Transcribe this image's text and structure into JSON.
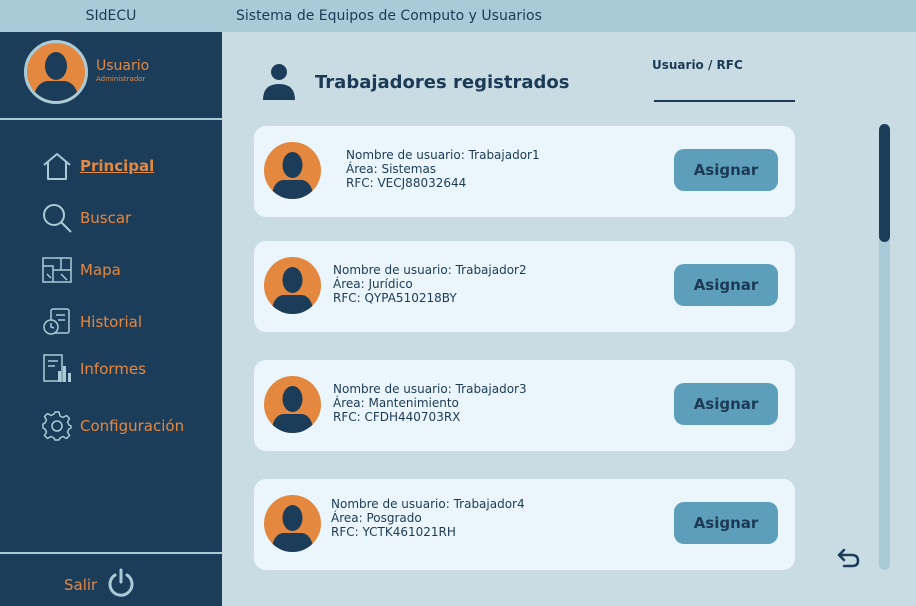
{
  "header": {
    "brand": "SIdECU",
    "system_title": "Sistema de Equipos de Computo y Usuarios"
  },
  "profile": {
    "name": "Usuario",
    "role": "Administrador"
  },
  "sidebar": {
    "items": [
      {
        "label": "Principal",
        "icon": "home-icon",
        "active": true
      },
      {
        "label": "Buscar",
        "icon": "search-icon"
      },
      {
        "label": "Mapa",
        "icon": "map-icon"
      },
      {
        "label": "Historial",
        "icon": "history-icon"
      },
      {
        "label": "Informes",
        "icon": "reports-icon"
      },
      {
        "label": "Configuración",
        "icon": "gear-icon"
      }
    ],
    "logout_label": "Salir"
  },
  "main": {
    "title": "Trabajadores registrados",
    "search_label": "Usuario / RFC",
    "search_value": "",
    "workers": [
      {
        "username": "Nombre de usuario: Trabajador1",
        "area": "Área: Sistemas",
        "rfc": "RFC: VECJ88032644",
        "button": "Asignar"
      },
      {
        "username": "Nombre de usuario: Trabajador2",
        "area": "Área: Jurídico",
        "rfc": "RFC: QYPA510218BY",
        "button": "Asignar"
      },
      {
        "username": "Nombre de usuario: Trabajador3",
        "area": "Área: Mantenimiento",
        "rfc": "RFC: CFDH440703RX",
        "button": "Asignar"
      },
      {
        "username": "Nombre de usuario: Trabajador4",
        "area": "Área: Posgrado",
        "rfc": "RFC: YCTK461021RH",
        "button": "Asignar"
      }
    ]
  },
  "colors": {
    "sidebar": "#1c3d5a",
    "accent": "#e4873f",
    "topbar": "#a9cbd7",
    "background": "#c9dce3",
    "card": "#eaf6fb",
    "button": "#5d9fbb"
  }
}
